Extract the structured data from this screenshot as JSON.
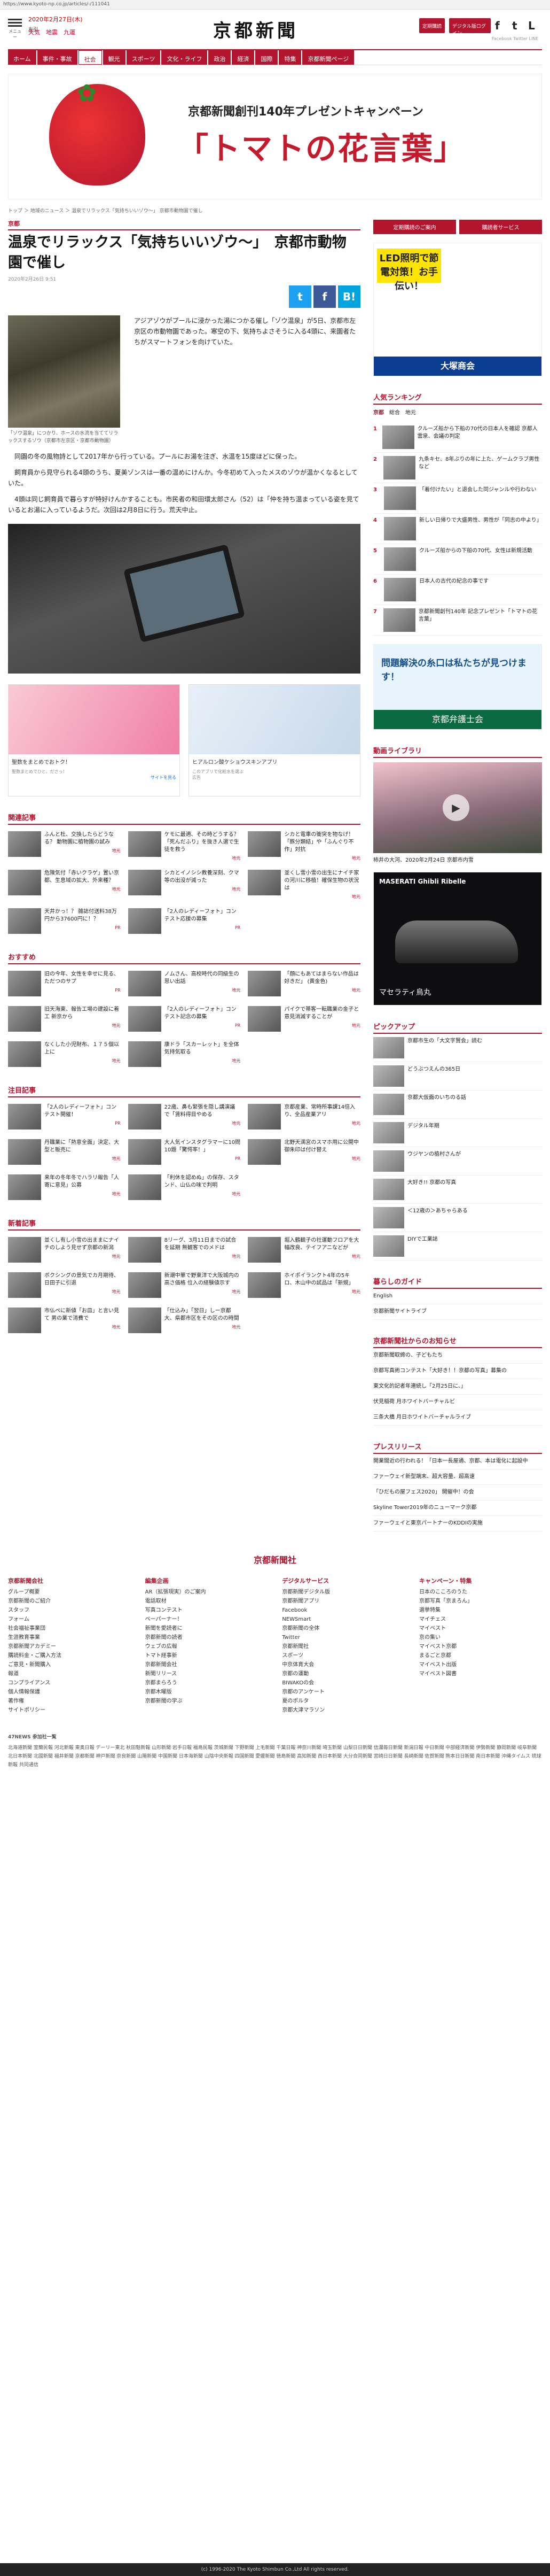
{
  "url": "https://www.kyoto-np.co.jp/articles/-/111041",
  "header": {
    "menu_label": "メニュー",
    "date": "2020年2月27日(木)",
    "rokuyo": "友引",
    "weather": "天気　地震　九運",
    "logo": "京都新聞",
    "btn_subscribe": "定期購読",
    "btn_digital": "デジタル版ログイン",
    "social_fb": "f",
    "social_tw": "t",
    "social_ln": "L",
    "social_labels": "Facebook  Twitter  LINE"
  },
  "nav": [
    "ホーム",
    "事件・事故",
    "社会",
    "観光",
    "スポーツ",
    "文化・ライフ",
    "政治",
    "経済",
    "国際",
    "特集",
    "京都新聞ページ"
  ],
  "nav_active": "社会",
  "banner": {
    "subtitle": "京都新聞創刊140年プレゼントキャンペーン",
    "title": "「トマトの花言葉」"
  },
  "breadcrumb": "トップ ＞ 地域のニュース ＞ 温泉でリラックス「気持ちいいゾウ〜」 京都市動物園で催し",
  "article": {
    "category": "京都",
    "title": "温泉でリラックス「気持ちいいゾウ〜」　京都市動物園で催し",
    "date": "2020年2月26日 9:51",
    "share": [
      "t",
      "f",
      "B!"
    ],
    "caption": "「ゾウ温泉」につかり、ホースの水流を当ててリラックスするゾウ（京都市左京区・京都市動物園）",
    "lead": "アジアゾウがプールに浸かった湯につかる催し「ゾウ温泉」が5日、京都市左京区の市動物園であった。寒空の下、気持ちよさそうに入る4頭に、来園者たちがスマートフォンを向けていた。",
    "paragraphs": [
      "同園の冬の風物詩として2017年から行っている。プールにお湯を注ぎ、水温を15度ほどに保った。",
      "飼育員から見守られる4頭のうち、夏美ゾンスは一番の温めにけんか。今冬初めて入ったメスのゾウが温かくなるとしていた。",
      "4頭は同じ飼育員で暮らすが特好けんかすることも。市民者の和田環太郎さん（52）は「仲を持ち温まっている姿を見ているとお湯に入っているようだ。次回は2月8日に行う。荒天中止。"
    ]
  },
  "ads": {
    "left_title": "聖数をまとめでおトク！",
    "left_sub": "聖数まとめでひと、ださっ！",
    "left_cta": "サイトを見る",
    "right_title": "ヒアルロン酸ケショウスキンアプリ",
    "right_sub": "このアプリで化粧水を選ぶ",
    "ad_label": "広告"
  },
  "related": {
    "title": "関連記事",
    "items": [
      {
        "t": "ふんと杜、交換したらどうなる？ 動物園に植物園の試み",
        "src": "地元"
      },
      {
        "t": "ケモに最適、その時どうする？ 「死んだふり」を抜き人選で生徒を救う",
        "src": "地元"
      },
      {
        "t": "シカと電車の衝突を物なげ！「豚分類結」や「ふんぐり不作」対抗",
        "src": "地元"
      },
      {
        "t": "危険気付「赤いクラゲ」置い京都、生息域の拡大、外来種？",
        "src": "地元"
      },
      {
        "t": "シカとイノシシ教養深刻、クマ等の出没が減った",
        "src": "地元"
      },
      {
        "t": "並くし雪小雪の出生にナイチ家の河川に移植！確保生物の状況は",
        "src": "地元"
      },
      {
        "t": "天井かっ！？ 雑誌付送料38万円から37600円に！？",
        "src": "PR"
      },
      {
        "t": "「2人のレディーフォト」コンテスト応援の募集",
        "src": "PR"
      }
    ]
  },
  "recommend": {
    "title": "おすすめ",
    "items": [
      {
        "t": "旧の今年、女性を幸せに見る、ただつのサプ",
        "src": "PR"
      },
      {
        "t": "ノムさん、高校時代の同級生の思い出話",
        "src": "地元"
      },
      {
        "t": "「顔にもあてはまらない作品は好きだ」 (黄金色)",
        "src": "地元"
      },
      {
        "t": "旧天海東、報告工場の建設に着工 新京から",
        "src": "地元"
      },
      {
        "t": "「2人のレディーフォト」コンテスト記念の募集",
        "src": "PR"
      },
      {
        "t": "パイクで帯客一転職業の金子と意見消滅することが",
        "src": "地元"
      },
      {
        "t": "なくした小児財布、１７５個以上に",
        "src": "地元"
      },
      {
        "t": "康ドラ「スカーレット」を全体気持気取る",
        "src": "地元"
      }
    ]
  },
  "attention": {
    "title": "注目記事",
    "items": [
      {
        "t": "「2人のレディーフォト」コンテスト開催！",
        "src": "PR"
      },
      {
        "t": "22歳、鼻も緊張を隠し講演議で「賃料得目やめる",
        "src": "地元"
      },
      {
        "t": "京都産業、常時所事課14倍入り、全品産業アリ",
        "src": "地元"
      },
      {
        "t": "丹職業に「熱意全面」決定、大型と販売に",
        "src": "地元"
      },
      {
        "t": "大人気インスタグラマーに10問10題「驚愕率！」",
        "src": "PR"
      },
      {
        "t": "北野天満宮のスマホ用に公開中 御朱印は付け替え",
        "src": "地元"
      },
      {
        "t": "来年の冬年冬でハラリ報告「人寄に意見」公募",
        "src": "地元"
      },
      {
        "t": "「利休を認めぬ」の保存、スタンド、山仏の味で判明",
        "src": "地元"
      }
    ]
  },
  "newest": {
    "title": "新着記事",
    "items": [
      {
        "t": "並くし有し小雪の出ままにナイチのしよう見せず京都の新潟",
        "src": "地元"
      },
      {
        "t": "8リーグ、3月11日までの試合を延期 無観客でのメドは",
        "src": "地元"
      },
      {
        "t": "堀入鶴観子の社運動フロアを大幅改良、テイフアニなどが",
        "src": "地元"
      },
      {
        "t": "ボクシングの景気でカ月期待、日田子に引退",
        "src": "地元"
      },
      {
        "t": "新潮中華で野東洋で大阪城内の高さ価格 位入の経験値示す",
        "src": "地元"
      },
      {
        "t": "ホイポイランクト4年の5キロ、木山中の試品は「新規」",
        "src": "地元"
      },
      {
        "t": "市仏ぺに新値「お皿」と言い見て 男の業で消費で",
        "src": "地元"
      },
      {
        "t": "「仕込み」「翌日」しー京都大、県都市区をその区のの時間",
        "src": "地元"
      }
    ]
  },
  "side": {
    "btn1": "定期購読のご案内",
    "btn2": "購読者サービス",
    "ad_text": "LED照明で節電対策！お手伝い！",
    "ad_company": "大塚商会",
    "ranking_title": "人気ランキング",
    "ranking_tabs": [
      "京都",
      "総合",
      "地元"
    ],
    "ranking": [
      "クルーズ船から下船の70代の日本人を確認 京都人 雲泉、会議の判定",
      "九条キセ、8年ぶりの年に上た、ゲームクラブ男性など",
      "「着付けたい」と退会した同ジャンルや行わない",
      "新しい日帰りで大盛男性、男性が「同志の中より」",
      "クルーズ船からの下船の70代、女性は新規活動",
      "日本人の古代の紀念の事です",
      "京都新聞創刊140年 記念プレゼント「トマトの花言葉」"
    ],
    "ad2_title": "問題解決の糸口は私たちが見つけます！",
    "ad2_org": "京都弁護士会",
    "video_title": "動画ライブラリ",
    "video_caption": "柿井の大河、2020年2月24日 京都市内雪",
    "car_ad": "MASERATI Ghibli Ribelle",
    "car_sub": "マセラティ烏丸",
    "pickup_title": "ピックアップ",
    "pickup": [
      "京都市生の「大文字賢会」読む",
      "どうぶつえんの365日",
      "京都大仮面のいちのる話",
      "デジタル年期",
      "ウジヤンの植村さんが",
      "大好き!! 京都の写真",
      "＜12歳の＞あちゃらある",
      "DIYで工業誌"
    ],
    "life_title": "暮らしのガイド",
    "life": [
      "English",
      "京都新聞サイトライブ"
    ],
    "notice_title": "京都新聞社からのお知らせ",
    "notice": [
      "京都新聞取締の、子どもたち",
      "京都写真術コンテスト「大好き！！京都の写真」募集の",
      "東文化的記者年連続し「2月25日に、」",
      "伏見稲荷 月ホワイトバーチャルビ",
      "三条大橋 月日ホワイトバーチャルライブ"
    ],
    "press_title": "プレスリリース",
    "press": [
      "開業間近の行われる！「日本一長屋通、京都、本は電化に起設中",
      "ファーウェイ新型端末、超大容量、超高速",
      "「ひだもの屋フェス2020」 開催中！の会",
      "Skyline Tower2019年のニューマーク京都",
      "ファーウェイと東京パートナーのKDDIの実施"
    ]
  },
  "footer": {
    "logo": "京都新聞社",
    "cols": [
      {
        "h": "京都新聞会社",
        "items": [
          "グループ概要",
          "京都新聞のご紹介",
          "スタッフ",
          "フォーム",
          "社会福祉事業団",
          "生涯教育事業",
          "京都新聞アカデミー",
          "購読料金・ご購入方法",
          "ご意見・新聞購入",
          "報道",
          "コンプライアンス",
          "個人情報保護",
          "著作権",
          "サイトポリシー"
        ]
      },
      {
        "h": "編集企画",
        "items": [
          "AR（拡張現実）のご案内",
          "電話取材",
          "写真コンテスト",
          "ペーパーナー！",
          "新聞を愛読者に",
          "京都新聞の読者",
          "ウェブの広報",
          "トマト経事新",
          "京都新聞会社",
          "新聞リリース",
          "京都まらろう",
          "京都木曜版",
          "京都新聞の学ぶ"
        ]
      },
      {
        "h": "デジタルサービス",
        "items": [
          "京都新聞デジタル版",
          "京都新聞アプリ",
          "Facebook",
          "NEWSmart",
          "京都新聞の全体",
          "Twitter",
          "京都新聞社",
          "スポーツ",
          "中京体育大会",
          "京都の運動",
          "BIWAKOの会",
          "京都のアンケート",
          "夏のポルタ",
          "京都大津マラソン"
        ]
      },
      {
        "h": "キャンペーン・特集",
        "items": [
          "日本のこころのうた",
          "京都写真「京まろん」",
          "選挙特集",
          "マイチェス",
          "マイベスト",
          "京の集い",
          "マイベスト京都",
          "まるごと京都",
          "マイベスト出版",
          "マイベスト図書"
        ]
      }
    ],
    "news47_title": "47NEWS 参加社一覧",
    "news47": "北海道新聞 室蘭民報 河北新報 東奥日報 デーリー東北 秋田魁新報 山形新聞 岩手日報 福島民報 茨城新聞 下野新聞 上毛新聞 千葉日報 神奈川新聞 埼玉新聞 山梨日日新聞 信濃毎日新聞 新潟日報 中日新聞 中部経済新聞 伊勢新聞 静岡新聞 岐阜新聞 北日本新聞 北國新聞 福井新聞 京都新聞 神戸新聞 奈良新聞 山陽新聞 中国新聞 日本海新聞 山陰中央新報 四国新聞 愛媛新聞 徳島新聞 高知新聞 西日本新聞 大分合同新聞 宮崎日日新聞 長崎新聞 佐賀新聞 熊本日日新聞 南日本新聞 沖縄タイムス 琉球新報 共同通信",
    "copyright": "(c) 1996-2020 The Kyoto Shimbun Co.,Ltd All rights reserved."
  }
}
